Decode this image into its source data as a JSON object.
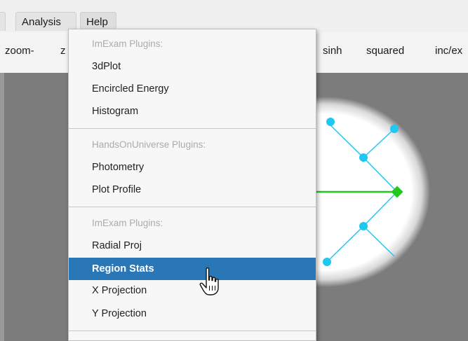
{
  "menubar": {
    "analysis": "Analysis",
    "help": "Help"
  },
  "toolbar": {
    "zoom_minus": "zoom-",
    "zoom_cut": "z",
    "sinh": "sinh",
    "squared": "squared",
    "incex": "inc/ex"
  },
  "menu": {
    "items": [
      {
        "label": "ImExam Plugins:",
        "kind": "header"
      },
      {
        "label": "3dPlot",
        "kind": "item"
      },
      {
        "label": "Encircled Energy",
        "kind": "item"
      },
      {
        "label": "Histogram",
        "kind": "item"
      },
      {
        "label": "HandsOnUniverse Plugins:",
        "kind": "header"
      },
      {
        "label": "Photometry",
        "kind": "item"
      },
      {
        "label": "Plot Profile",
        "kind": "item"
      },
      {
        "label": "ImExam Plugins:",
        "kind": "header"
      },
      {
        "label": "Radial Proj",
        "kind": "item"
      },
      {
        "label": "Region Stats",
        "kind": "item",
        "selected": true
      },
      {
        "label": "X Projection",
        "kind": "item"
      },
      {
        "label": "Y Projection",
        "kind": "item"
      }
    ]
  },
  "colors": {
    "selection": "#2a77b8",
    "region_handles": "#1ec8f0",
    "region_axis": "#22c81e"
  }
}
